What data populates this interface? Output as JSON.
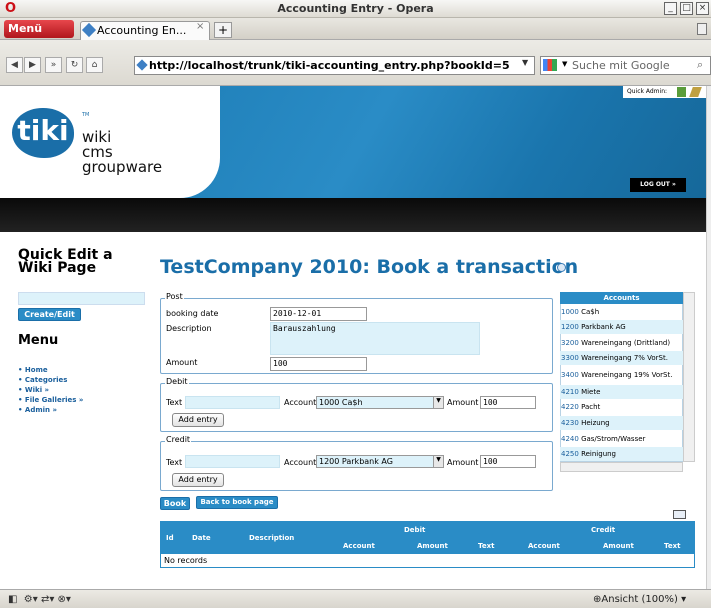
{
  "window": {
    "title": "Accounting Entry - Opera"
  },
  "browser": {
    "menu_label": "Menü",
    "tab_label": "Accounting En...",
    "tab_close": "×",
    "new_tab": "+",
    "url": "http://localhost/trunk/tiki-accounting_entry.php?bookId=5",
    "search_placeholder": "Suche mit Google",
    "zoom_label": "Ansicht (100%)"
  },
  "header": {
    "logo_main": "tiki",
    "logo_tm": "TM",
    "logo_lines": [
      "wiki",
      "cms",
      "groupware"
    ],
    "quick_admin": "Quick Admin:",
    "logout": "LOG OUT »"
  },
  "sidebar": {
    "quick_edit_title": "Quick Edit a Wiki Page",
    "create_edit": "Create/Edit",
    "menu_title": "Menu",
    "items": [
      "Home",
      "Categories",
      "Wiki »",
      "File Galleries »",
      "Admin »"
    ]
  },
  "main": {
    "title": "TestCompany 2010: Book a transaction",
    "post": {
      "legend": "Post",
      "booking_date_label": "booking date",
      "booking_date": "2010-12-01",
      "description_label": "Description",
      "description": "Barauszahlung",
      "amount_label": "Amount",
      "amount": "100"
    },
    "debit": {
      "legend": "Debit",
      "text_label": "Text",
      "account_label": "Account",
      "account": "1000 Ca$h",
      "amount_label": "Amount",
      "amount": "100",
      "add_entry": "Add entry"
    },
    "credit": {
      "legend": "Credit",
      "text_label": "Text",
      "account_label": "Account",
      "account": "1200 Parkbank AG",
      "amount_label": "Amount",
      "amount": "100",
      "add_entry": "Add entry"
    },
    "book_button": "Book",
    "back_button": "Back to book page"
  },
  "accounts": {
    "header": "Accounts",
    "rows": [
      {
        "num": "1000",
        "name": "Ca$h"
      },
      {
        "num": "1200",
        "name": "Parkbank AG"
      },
      {
        "num": "3200",
        "name": "Wareneingang (Drittland)"
      },
      {
        "num": "3300",
        "name": "Wareneingang 7% VorSt."
      },
      {
        "num": "3400",
        "name": "Wareneingang 19% VorSt."
      },
      {
        "num": "4210",
        "name": "Miete"
      },
      {
        "num": "4220",
        "name": "Pacht"
      },
      {
        "num": "4230",
        "name": "Heizung"
      },
      {
        "num": "4240",
        "name": "Gas/Strom/Wasser"
      },
      {
        "num": "4250",
        "name": "Reinigung"
      }
    ]
  },
  "table": {
    "columns": {
      "id": "Id",
      "date": "Date",
      "description": "Description",
      "debit": "Debit",
      "credit": "Credit",
      "account": "Account",
      "amount": "Amount",
      "text": "Text"
    },
    "empty": "No records"
  }
}
